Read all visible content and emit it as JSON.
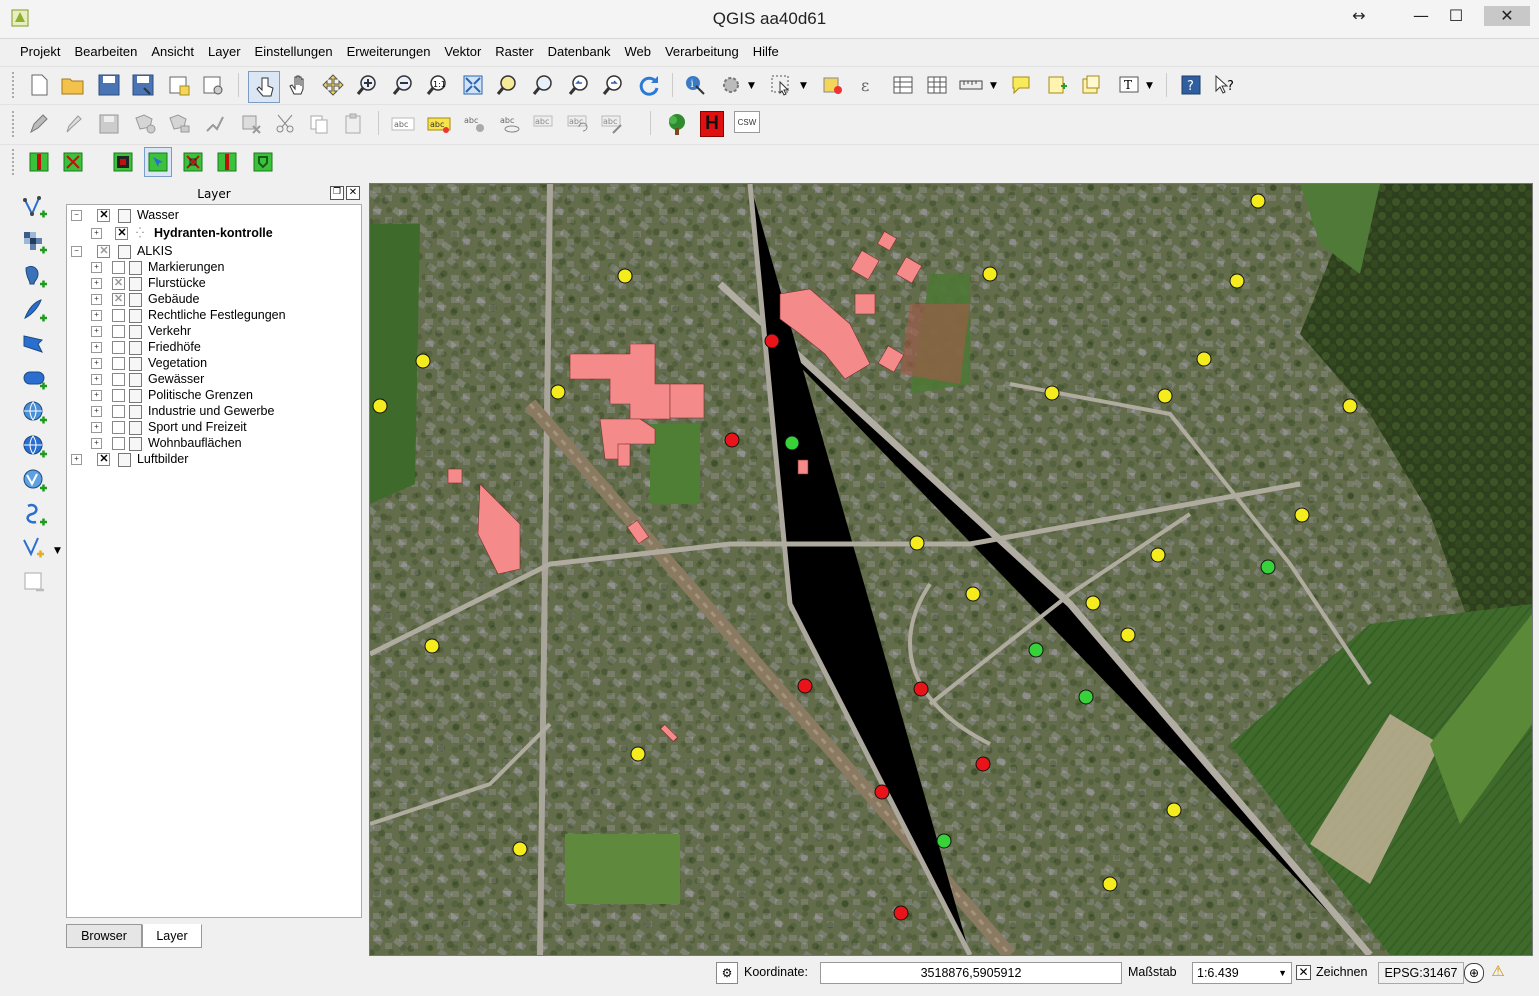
{
  "window": {
    "title": "QGIS aa40d61"
  },
  "menu": [
    "Projekt",
    "Bearbeiten",
    "Ansicht",
    "Layer",
    "Einstellungen",
    "Erweiterungen",
    "Vektor",
    "Raster",
    "Datenbank",
    "Web",
    "Verarbeitung",
    "Hilfe"
  ],
  "toolbar_plugins": {
    "csw_label": "CSW",
    "h_label": "H"
  },
  "layer_panel": {
    "title": "Layer",
    "groups": [
      {
        "label": "Wasser",
        "checked": true,
        "children": [
          {
            "label": "Hydranten-kontrolle",
            "checked": true,
            "bold": true
          }
        ]
      },
      {
        "label": "ALKIS",
        "checked": "partial",
        "children": [
          {
            "label": "Markierungen",
            "checked": false
          },
          {
            "label": "Flurstücke",
            "checked": "partial"
          },
          {
            "label": "Gebäude",
            "checked": "partial"
          },
          {
            "label": "Rechtliche Festlegungen",
            "checked": false
          },
          {
            "label": "Verkehr",
            "checked": false
          },
          {
            "label": "Friedhöfe",
            "checked": false
          },
          {
            "label": "Vegetation",
            "checked": false
          },
          {
            "label": "Gewässer",
            "checked": false
          },
          {
            "label": "Politische Grenzen",
            "checked": false
          },
          {
            "label": "Industrie und Gewerbe",
            "checked": false
          },
          {
            "label": "Sport und Freizeit",
            "checked": false
          },
          {
            "label": "Wohnbauflächen",
            "checked": false
          }
        ]
      },
      {
        "label": "Luftbilder",
        "checked": true,
        "children": []
      }
    ],
    "tabs": [
      "Browser",
      "Layer"
    ]
  },
  "statusbar": {
    "coord_label": "Koordinate:",
    "coord_value": "3518876,5905912",
    "scale_label": "Maßstab",
    "scale_value": "1:6.439",
    "render_label": "Zeichnen",
    "crs": "EPSG:31467"
  },
  "colors": {
    "hydrant_yellow": "#f4ec1c",
    "hydrant_red": "#e8141a",
    "hydrant_green": "#37d23a",
    "building_highlight": "#f48a8a",
    "building_grey": "#9a9a9a"
  }
}
